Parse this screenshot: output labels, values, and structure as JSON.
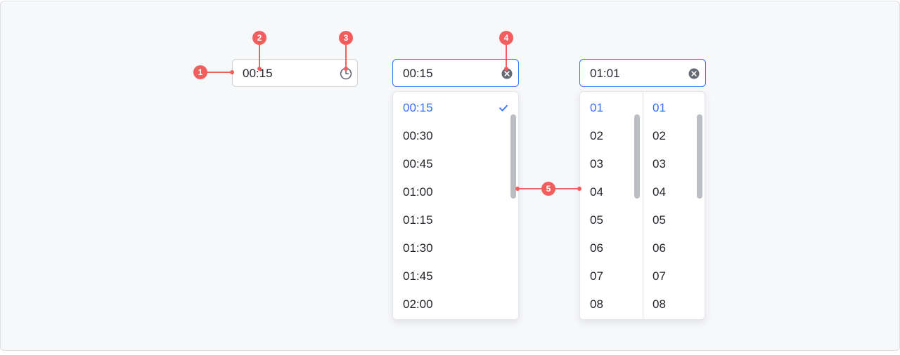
{
  "field_default": {
    "value": "00:15",
    "icon": "clock-icon"
  },
  "field_list": {
    "value": "00:15",
    "icon": "clear-icon"
  },
  "field_columns": {
    "value": "01:01",
    "icon": "clear-icon"
  },
  "list_panel": {
    "options": [
      "00:15",
      "00:30",
      "00:45",
      "01:00",
      "01:15",
      "01:30",
      "01:45",
      "02:00"
    ],
    "selected_index": 0,
    "selected_icon": "check-icon"
  },
  "columns_panel": {
    "hours": [
      "01",
      "02",
      "03",
      "04",
      "05",
      "06",
      "07",
      "08"
    ],
    "minutes": [
      "01",
      "02",
      "03",
      "04",
      "05",
      "06",
      "07",
      "08"
    ],
    "selected_index": 0
  },
  "markers": [
    "1",
    "2",
    "3",
    "4",
    "5"
  ],
  "colors": {
    "accent": "#3370ff",
    "marker": "#f25e5e",
    "text": "#1f2329",
    "icon": "#646a73"
  }
}
